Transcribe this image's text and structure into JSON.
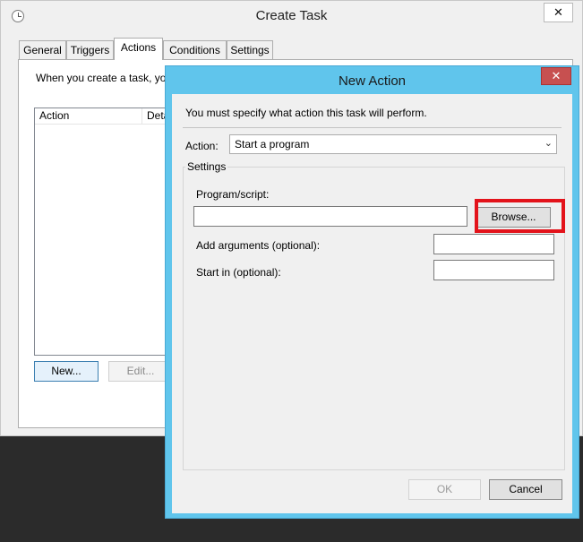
{
  "create_task": {
    "title": "Create Task",
    "close_glyph": "✕",
    "tabs": [
      {
        "label": "General"
      },
      {
        "label": "Triggers"
      },
      {
        "label": "Actions"
      },
      {
        "label": "Conditions"
      },
      {
        "label": "Settings"
      }
    ],
    "active_tab": "Actions",
    "description": "When you create a task, you",
    "columns": [
      "Action",
      "Deta"
    ],
    "buttons": {
      "new": "New...",
      "edit": "Edit..."
    }
  },
  "new_action": {
    "title": "New Action",
    "close_glyph": "✕",
    "prompt": "You must specify what action this task will perform.",
    "action_label": "Action:",
    "action_value": "Start a program",
    "settings_legend": "Settings",
    "program_label": "Program/script:",
    "program_value": "",
    "browse_label": "Browse...",
    "arguments_label": "Add arguments (optional):",
    "arguments_value": "",
    "start_in_label": "Start in (optional):",
    "start_in_value": "",
    "ok_label": "OK",
    "cancel_label": "Cancel"
  },
  "colors": {
    "dialog_frame": "#60c5ec",
    "close_button": "#c75050",
    "highlight": "#e3131b"
  },
  "icons": {
    "app": "clock-icon",
    "close": "close-icon",
    "dropdown": "chevron-down-icon"
  }
}
